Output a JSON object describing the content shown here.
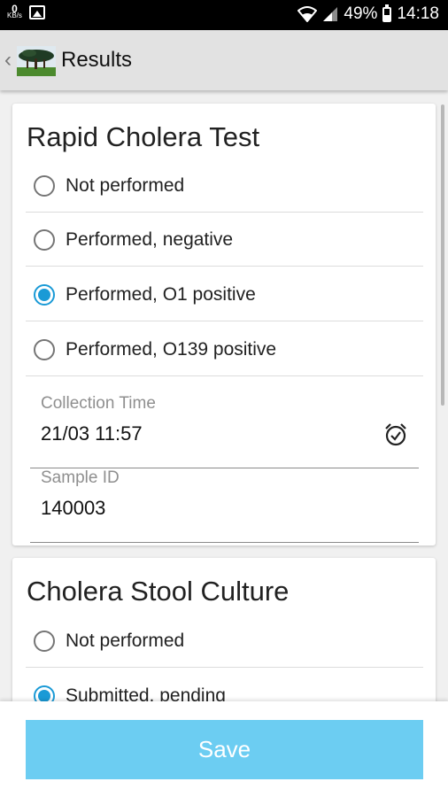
{
  "status_bar": {
    "data_icon_top": "0",
    "data_icon_unit": "KB/s",
    "battery": "49%",
    "time": "14:18",
    "icons": [
      "image-icon",
      "wifi-icon",
      "signal-icon",
      "battery-icon"
    ]
  },
  "app_bar": {
    "title": "Results",
    "back_icon": "chevron-left-icon",
    "logo_icon": "tree-logo-icon"
  },
  "rapid_test": {
    "title": "Rapid Cholera Test",
    "options": [
      {
        "label": "Not performed",
        "selected": false
      },
      {
        "label": "Performed, negative",
        "selected": false
      },
      {
        "label": "Performed, O1 positive",
        "selected": true
      },
      {
        "label": "Performed, O139 positive",
        "selected": false
      }
    ],
    "collection_time": {
      "label": "Collection Time",
      "value": "21/03 11:57",
      "icon": "alarm-clock-icon"
    },
    "sample_id": {
      "label": "Sample ID",
      "value": "140003"
    }
  },
  "stool_culture": {
    "title": "Cholera Stool Culture",
    "options": [
      {
        "label": "Not performed",
        "selected": false
      },
      {
        "label": "Submitted, pending",
        "selected": true
      }
    ]
  },
  "footer": {
    "save_label": "Save"
  },
  "colors": {
    "accent": "#1a9ad6",
    "save_button": "#6ccdf2",
    "app_bar": "#e2e2e2"
  }
}
